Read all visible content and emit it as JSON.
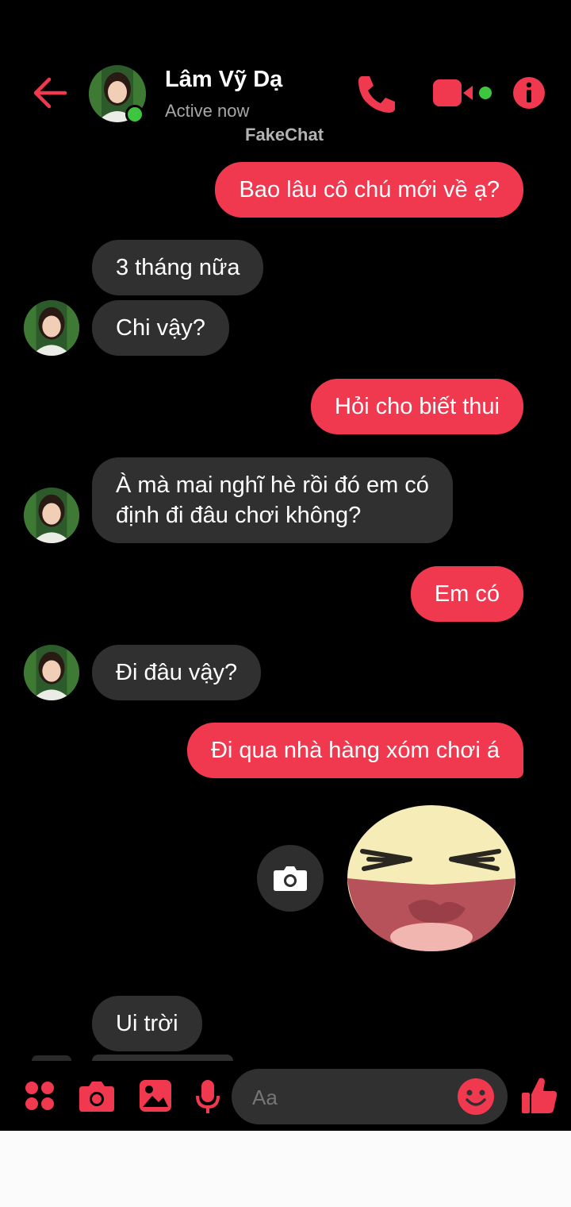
{
  "colors": {
    "accent": "#f0384f",
    "incoming_bubble": "#303030",
    "online": "#3ec73e"
  },
  "header": {
    "name": "Lâm Vỹ Dạ",
    "status": "Active now",
    "watermark": "FakeChat",
    "icons": [
      "back-arrow-icon",
      "phone-icon",
      "video-camera-icon",
      "info-icon"
    ]
  },
  "messages": [
    {
      "from": "me",
      "text": "Bao lâu cô chú mới về ạ?"
    },
    {
      "from": "them",
      "text": "3 tháng nữa"
    },
    {
      "from": "them",
      "text": "Chi vậy?"
    },
    {
      "from": "me",
      "text": "Hỏi cho biết thui"
    },
    {
      "from": "them",
      "text_line1": "À mà mai nghĩ hè rồi đó em có",
      "text_line2": "định đi đâu chơi không?"
    },
    {
      "from": "me",
      "text": "Em có"
    },
    {
      "from": "them",
      "text": "Đi đâu vậy?"
    },
    {
      "from": "me",
      "text": "Đi qua nhà hàng xóm chơi á"
    },
    {
      "from": "me",
      "type": "sticker",
      "sticker": "laughing-face"
    },
    {
      "from": "them",
      "text": "Ui trời"
    }
  ],
  "composer": {
    "placeholder": "Aa",
    "icons": [
      "apps-grid-icon",
      "camera-icon",
      "gallery-icon",
      "microphone-icon",
      "emoji-icon",
      "thumbs-up-icon"
    ]
  }
}
